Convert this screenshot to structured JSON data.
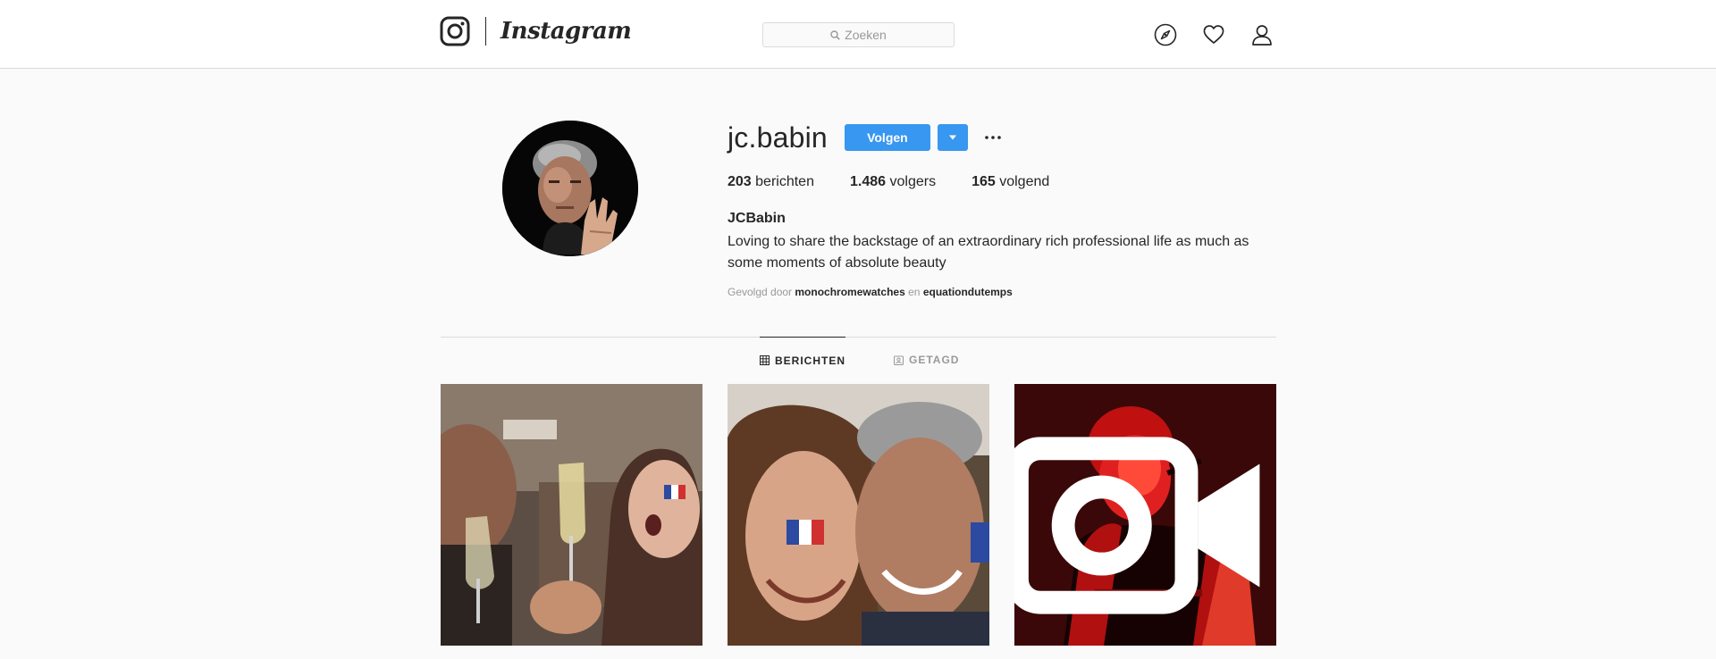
{
  "nav": {
    "logo_word": "Instagram",
    "search_placeholder": "Zoeken",
    "icons": [
      "compass-icon",
      "heart-icon",
      "user-icon"
    ]
  },
  "profile": {
    "username": "jc.babin",
    "follow_label": "Volgen",
    "stats": {
      "posts_count": "203",
      "posts_label": "berichten",
      "followers_count": "1.486",
      "followers_label": "volgers",
      "following_count": "165",
      "following_label": "volgend"
    },
    "full_name": "JCBabin",
    "bio": "Loving to share the backstage of an extraordinary rich professional life as much as some moments of absolute beauty",
    "followed_by": {
      "prefix": "Gevolgd door",
      "account_1": "monochromewatches",
      "joiner": "en",
      "account_2": "equationdutemps"
    }
  },
  "tabs": {
    "posts": "BERICHTEN",
    "tagged": "GETAGD",
    "active": "posts"
  },
  "posts": [
    {
      "kind": "photo"
    },
    {
      "kind": "photo"
    },
    {
      "kind": "video"
    }
  ],
  "colors": {
    "accent": "#3897f0",
    "border": "#dbdbdb",
    "background": "#fafafa",
    "text": "#262626",
    "muted": "#999999"
  }
}
